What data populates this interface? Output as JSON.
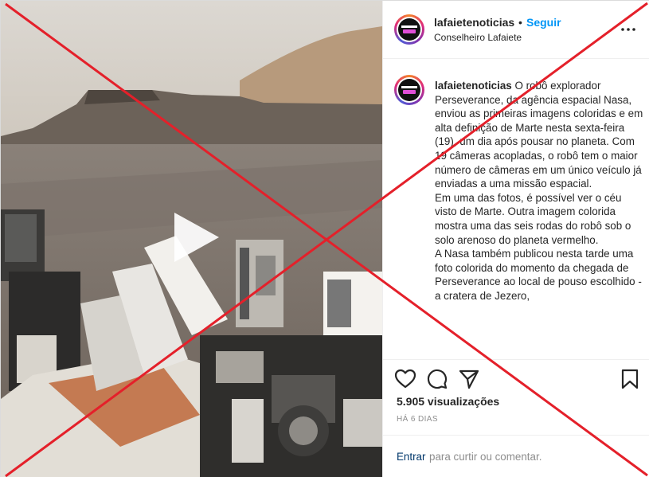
{
  "post": {
    "username": "lafaietenoticias",
    "separator": "•",
    "follow_label": "Seguir",
    "location": "Conselheiro Lafaiete",
    "more_icon": "more-horizontal-icon"
  },
  "caption": {
    "username": "lafaietenoticias",
    "lines": [
      "O robô explorador Perseverance, da agência espacial Nasa, enviou as primeiras imagens coloridas e em alta definição de Marte nesta sexta-feira (19), um dia após pousar no planeta. Com 19 câmeras acopladas, o robô tem o maior número de câmeras em um único veículo já enviadas a uma missão espacial.",
      "Em uma das fotos, é possível ver o céu visto de Marte. Outra imagem colorida mostra uma das seis rodas do robô sob o solo arenoso do planeta vermelho.",
      "A Nasa também publicou nesta tarde uma foto colorida do momento da chegada de Perseverance ao local de pouso escolhido - a cratera de Jezero,"
    ]
  },
  "actions": {
    "like_icon": "heart-icon",
    "comment_icon": "comment-icon",
    "share_icon": "share-icon",
    "save_icon": "bookmark-icon",
    "views": "5.905 visualizações",
    "time_ago": "HÁ 6 DIAS"
  },
  "comment": {
    "login_label": "Entrar",
    "prompt": "para curtir ou comentar."
  },
  "media": {
    "type": "video",
    "play_icon": "play-icon"
  },
  "overlay": {
    "mark": "red-cross",
    "color": "#e4202a"
  }
}
